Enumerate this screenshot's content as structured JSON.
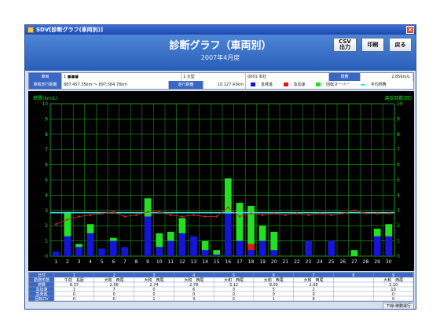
{
  "window": {
    "title": "SDV[診断グラフ(車両別)]",
    "close_glyph": "×"
  },
  "header": {
    "title": "診断グラフ（車両別）",
    "period": "2007年4月度"
  },
  "buttons": {
    "csv_line1": "CSV",
    "csv_line2": "出力",
    "print": "印刷",
    "back": "戻る"
  },
  "info": {
    "row1": {
      "vehicle_label": "車両",
      "vehicle_value": "1 ■■■",
      "type_value": "1 大型",
      "office_value": "0001 本社",
      "fuel_label": "燃費",
      "fuel_value": "2.85Km/L"
    },
    "row2": {
      "odo_label": "車検走行距離",
      "odo_value": "887,457.35km ～ 897,584.78km",
      "run_label": "走行距離",
      "run_value": "10,127.43km",
      "legend": [
        {
          "label": "：急発進",
          "color": "#1515d6"
        },
        {
          "label": "：急加速",
          "color": "#e01818"
        },
        {
          "label": "：回転オーバー",
          "color": "#22e022"
        },
        {
          "label": "：平均燃費",
          "color": "#3fe0e0"
        }
      ]
    }
  },
  "chart_data": {
    "type": "bar",
    "left_axis_label": "燃費(km/L)",
    "right_axis_label": "違反回数(回)",
    "ylim": [
      0,
      10
    ],
    "y2lim": [
      0,
      10
    ],
    "yticks": [
      "0",
      "1",
      "2",
      "3",
      "4",
      "5",
      "6",
      "7",
      "8",
      "9",
      "10"
    ],
    "categories": [
      "1",
      "2",
      "3",
      "4",
      "5",
      "6",
      "7",
      "8",
      "9",
      "10",
      "11",
      "12",
      "13",
      "14",
      "15",
      "16",
      "17",
      "18",
      "19",
      "20",
      "21",
      "22",
      "23",
      "24",
      "25",
      "26",
      "27",
      "28",
      "29",
      "30"
    ],
    "series": [
      {
        "name": "：急発進",
        "color": "#1515d6",
        "values": [
          0.3,
          1.3,
          0.6,
          1.5,
          0.5,
          1.0,
          0.6,
          0,
          2.6,
          0.6,
          1.0,
          1.5,
          1.3,
          0.4,
          0.1,
          2.8,
          1.0,
          0.4,
          1.0,
          0.4,
          0,
          0,
          1.0,
          0,
          1.0,
          0,
          0,
          0,
          1.3,
          1.3
        ]
      },
      {
        "name": "：急加速",
        "color": "#e01818",
        "values": [
          0,
          0,
          0,
          0,
          0,
          0,
          0,
          0,
          0,
          0,
          0,
          0,
          0,
          0,
          0,
          0,
          0,
          0.4,
          0,
          0,
          0,
          0,
          0,
          0,
          0,
          0,
          0,
          0,
          0,
          0
        ]
      },
      {
        "name": "：回転オーバー",
        "color": "#22e022",
        "values": [
          0,
          1.6,
          0.2,
          0.6,
          0,
          0.2,
          0,
          0,
          1.2,
          0.9,
          0.6,
          1.0,
          0,
          0.6,
          0.3,
          2.3,
          2.5,
          2.5,
          1.0,
          1.2,
          0,
          0,
          0,
          0,
          0,
          0,
          0.4,
          0,
          0.5,
          0.8
        ]
      }
    ],
    "avg_fuel_line": 2.85,
    "line_series": {
      "name": "fuel",
      "color": "#d82020",
      "values": [
        2.1,
        2.4,
        2.6,
        2.7,
        2.8,
        2.9,
        2.6,
        2.7,
        2.9,
        2.9,
        2.7,
        2.6,
        2.7,
        2.6,
        2.6,
        3.2,
        2.6,
        2.8,
        2.7,
        2.8,
        2.7,
        2.8,
        2.7,
        2.8,
        2.7,
        2.8,
        3.0,
        2.8,
        2.8,
        2.8
      ]
    }
  },
  "table": {
    "row_labels": [
      "日付",
      "勤務形態",
      "燃費",
      "急加速",
      "急発進",
      "回転OV"
    ],
    "days": [
      {
        "day": "1",
        "type": "午前　長距",
        "fuel": "8.37",
        "a": "1",
        "b": "0",
        "c": "0"
      },
      {
        "day": "2",
        "type": "大和　西尾",
        "fuel": "2.56",
        "a": "7",
        "b": "0",
        "c": "0"
      },
      {
        "day": "3",
        "type": "大和　西尾",
        "fuel": "2.74",
        "a": "0",
        "b": "0",
        "c": "1"
      },
      {
        "day": "4",
        "type": "大和　西尾",
        "fuel": "2.78",
        "a": "6",
        "b": "0",
        "c": "3"
      },
      {
        "day": "5",
        "type": "大和　西尾",
        "fuel": "3.12",
        "a": "3",
        "b": "0",
        "c": "2"
      },
      {
        "day": "6",
        "type": "大和　西尾",
        "fuel": "8.00",
        "a": "5",
        "b": "0",
        "c": "1"
      },
      {
        "day": "7",
        "type": "大和　西尾",
        "fuel": "2.08",
        "a": "2",
        "b": "0",
        "c": "6"
      },
      {
        "day": "8",
        "type": "",
        "fuel": "",
        "a": "",
        "b": "",
        "c": ""
      },
      {
        "day": "9",
        "type": "大和　西尾",
        "fuel": "3.10",
        "a": "10",
        "b": "0",
        "c": "0"
      }
    ]
  },
  "footer": {
    "note": "下線:稼動運行"
  }
}
